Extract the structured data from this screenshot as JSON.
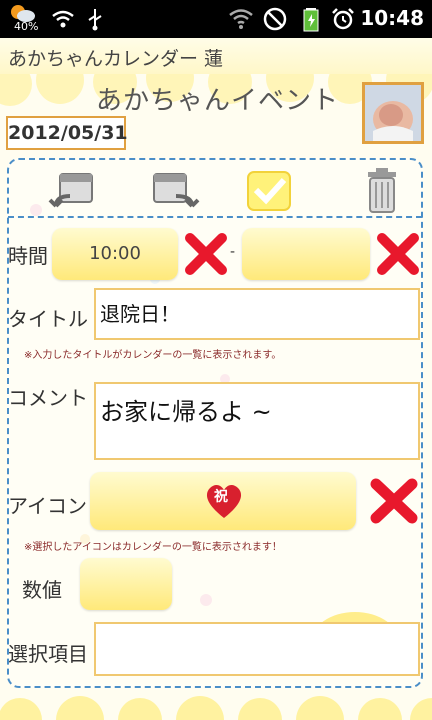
{
  "status_bar": {
    "battery_percent": "40%",
    "time": "10:48"
  },
  "app": {
    "title": "あかちゃんカレンダー 蓮"
  },
  "page": {
    "heading": "あかちゃんイベント",
    "date": "2012/05/31"
  },
  "form": {
    "time_label": "時間",
    "time_start": "10:00",
    "time_separator": "-",
    "time_end": "",
    "title_label": "タイトル",
    "title_value": "退院日！",
    "title_note": "※入力したタイトルがカレンダーの一覧に表示されます。",
    "comment_label": "コメント",
    "comment_value": "お家に帰るよ ~",
    "icon_label": "アイコン",
    "icon_glyph": "祝",
    "icon_note": "※選択したアイコンはカレンダーの一覧に表示されます！",
    "number_label": "数値",
    "number_value": "",
    "choice_label": "選択項目",
    "choice_value": ""
  },
  "icons": {
    "toolbar": [
      "prev-event-icon",
      "next-event-icon",
      "confirm-check-icon",
      "trash-icon"
    ],
    "clear": "clear-x-icon",
    "status": [
      "weather-icon",
      "wifi-icon",
      "usb-icon",
      "no-signal-icon",
      "battery-icon",
      "alarm-icon"
    ]
  },
  "colors": {
    "panel_border": "#4a8ec8",
    "clear_x": "#e8182c",
    "button_yellow": "#ffe97a",
    "date_border": "#e0a040"
  }
}
